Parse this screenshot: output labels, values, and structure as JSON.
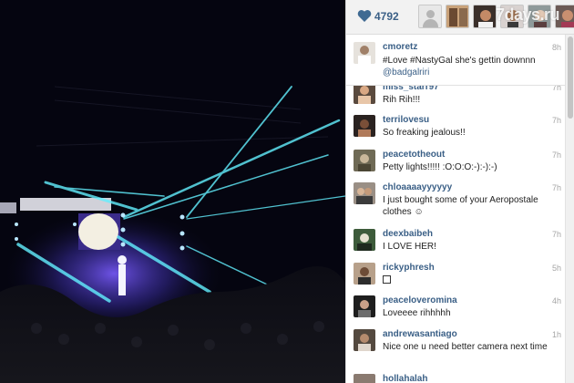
{
  "likes": {
    "count": "4792"
  },
  "watermark": "7days.ru",
  "caption": {
    "user": "cmoretz",
    "time": "8h",
    "text": "#Love #NastyGal she's gettin downnn",
    "mention": "@badgalriri"
  },
  "comments": [
    {
      "user": "miss_starr97",
      "time": "7h",
      "text": "Rih Rih!!!"
    },
    {
      "user": "terrilovesu",
      "time": "7h",
      "text": "So freaking jealous!!"
    },
    {
      "user": "peacetotheout",
      "time": "7h",
      "text": "Petty lights!!!!! :O:O:O:-):-):-)"
    },
    {
      "user": "chloaaaayyyyyy",
      "time": "7h",
      "text": "I just bought some of your Aeropostale clothes ☺"
    },
    {
      "user": "deexbaibeh",
      "time": "7h",
      "text": "I LOVE HER!"
    },
    {
      "user": "rickyphresh",
      "time": "5h",
      "text": ""
    },
    {
      "user": "peaceloveromina",
      "time": "4h",
      "text": "Loveeee rihhhhh"
    },
    {
      "user": "andrewasantiago",
      "time": "1h",
      "text": "Nice one u need better camera next time"
    },
    {
      "user": "hollahalah",
      "time": "",
      "text": ""
    }
  ],
  "colors": {
    "username": "#3a5f86",
    "heart": "#3f6a92"
  }
}
